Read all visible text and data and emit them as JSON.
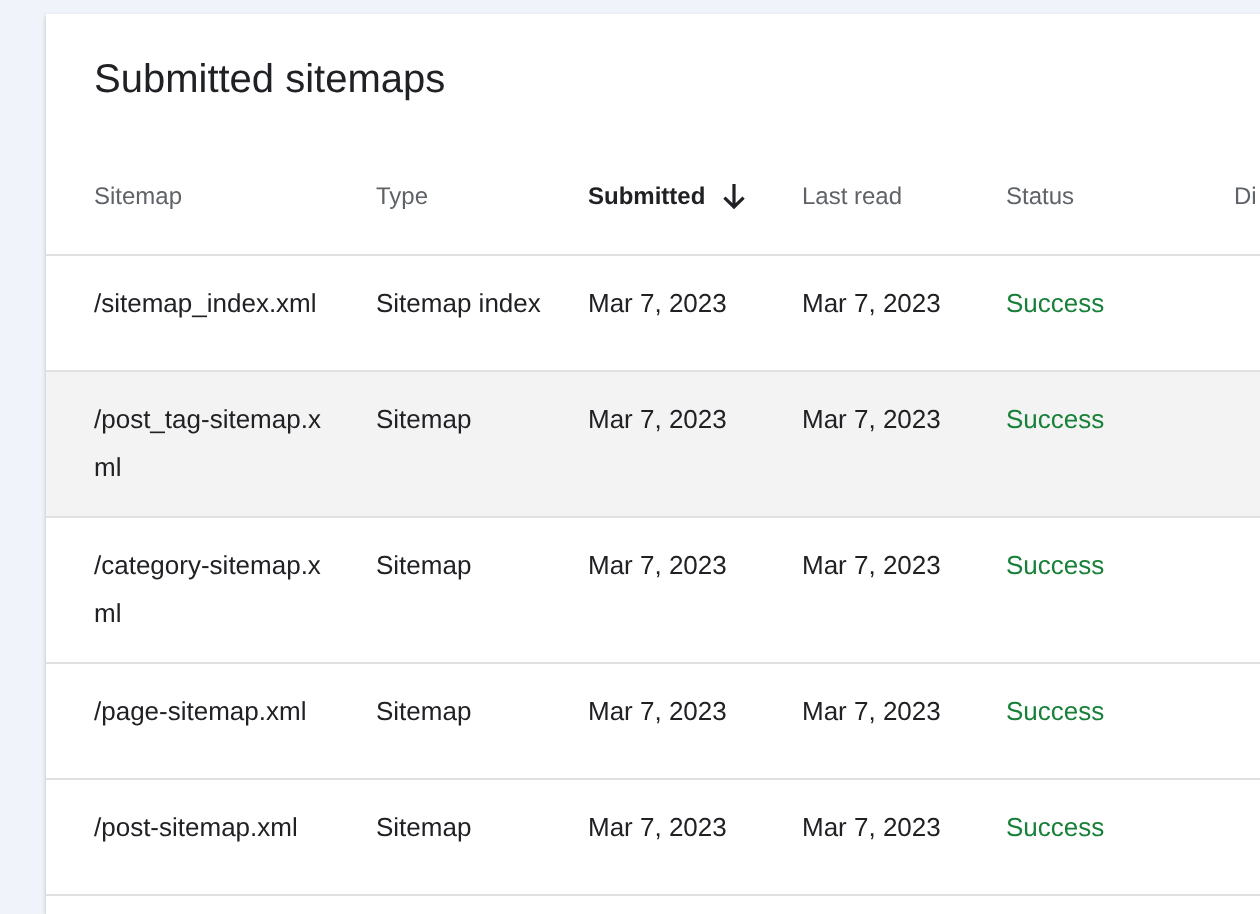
{
  "card": {
    "title": "Submitted sitemaps"
  },
  "table": {
    "columns": [
      {
        "label": "Sitemap",
        "sorted": false
      },
      {
        "label": "Type",
        "sorted": false
      },
      {
        "label": "Submitted",
        "sorted": true
      },
      {
        "label": "Last read",
        "sorted": false
      },
      {
        "label": "Status",
        "sorted": false
      },
      {
        "label": "Di",
        "sorted": false
      }
    ],
    "rows": [
      {
        "sitemap": "/sitemap_index.xml",
        "type": "Sitemap index",
        "submitted": "Mar 7, 2023",
        "last_read": "Mar 7, 2023",
        "status": "Success",
        "highlighted": false
      },
      {
        "sitemap": "/post_tag-sitemap.xml",
        "type": "Sitemap",
        "submitted": "Mar 7, 2023",
        "last_read": "Mar 7, 2023",
        "status": "Success",
        "highlighted": true
      },
      {
        "sitemap": "/category-sitemap.xml",
        "type": "Sitemap",
        "submitted": "Mar 7, 2023",
        "last_read": "Mar 7, 2023",
        "status": "Success",
        "highlighted": false
      },
      {
        "sitemap": "/page-sitemap.xml",
        "type": "Sitemap",
        "submitted": "Mar 7, 2023",
        "last_read": "Mar 7, 2023",
        "status": "Success",
        "highlighted": false
      },
      {
        "sitemap": "/post-sitemap.xml",
        "type": "Sitemap",
        "submitted": "Mar 7, 2023",
        "last_read": "Mar 7, 2023",
        "status": "Success",
        "highlighted": false
      }
    ]
  }
}
